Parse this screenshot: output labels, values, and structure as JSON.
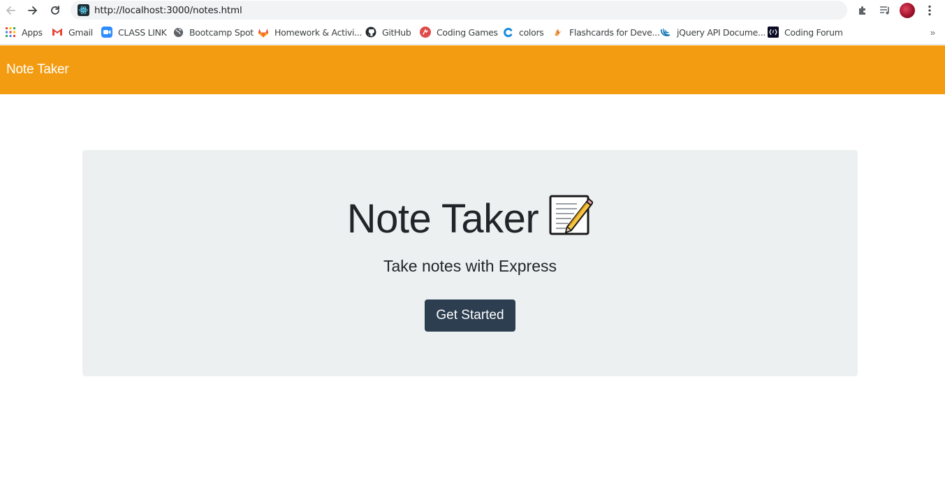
{
  "browser": {
    "url": "http://localhost:3000/notes.html",
    "bookmarks": [
      {
        "label": "Apps",
        "icon": "apps-grid-icon"
      },
      {
        "label": "Gmail",
        "icon": "gmail-icon"
      },
      {
        "label": "CLASS LINK",
        "icon": "zoom-icon"
      },
      {
        "label": "Bootcamp Spot",
        "icon": "globe-icon"
      },
      {
        "label": "Homework & Activi...",
        "icon": "gitlab-icon"
      },
      {
        "label": "GitHub",
        "icon": "github-icon"
      },
      {
        "label": "Coding Games",
        "icon": "coding-games-icon"
      },
      {
        "label": "colors",
        "icon": "colors-icon"
      },
      {
        "label": "Flashcards for Deve...",
        "icon": "flashcards-icon"
      },
      {
        "label": "jQuery API Docume...",
        "icon": "jquery-icon"
      },
      {
        "label": "Coding Forum",
        "icon": "coding-forum-icon"
      }
    ],
    "bookmarks_overflow": "»"
  },
  "navbar": {
    "brand": "Note Taker",
    "color": "#f39c12"
  },
  "jumbotron": {
    "title": "Note Taker",
    "title_icon": "memo-icon",
    "subtitle": "Take notes with Express",
    "button_label": "Get Started",
    "button_color": "#2c3e50",
    "background": "#ecf0f1"
  }
}
